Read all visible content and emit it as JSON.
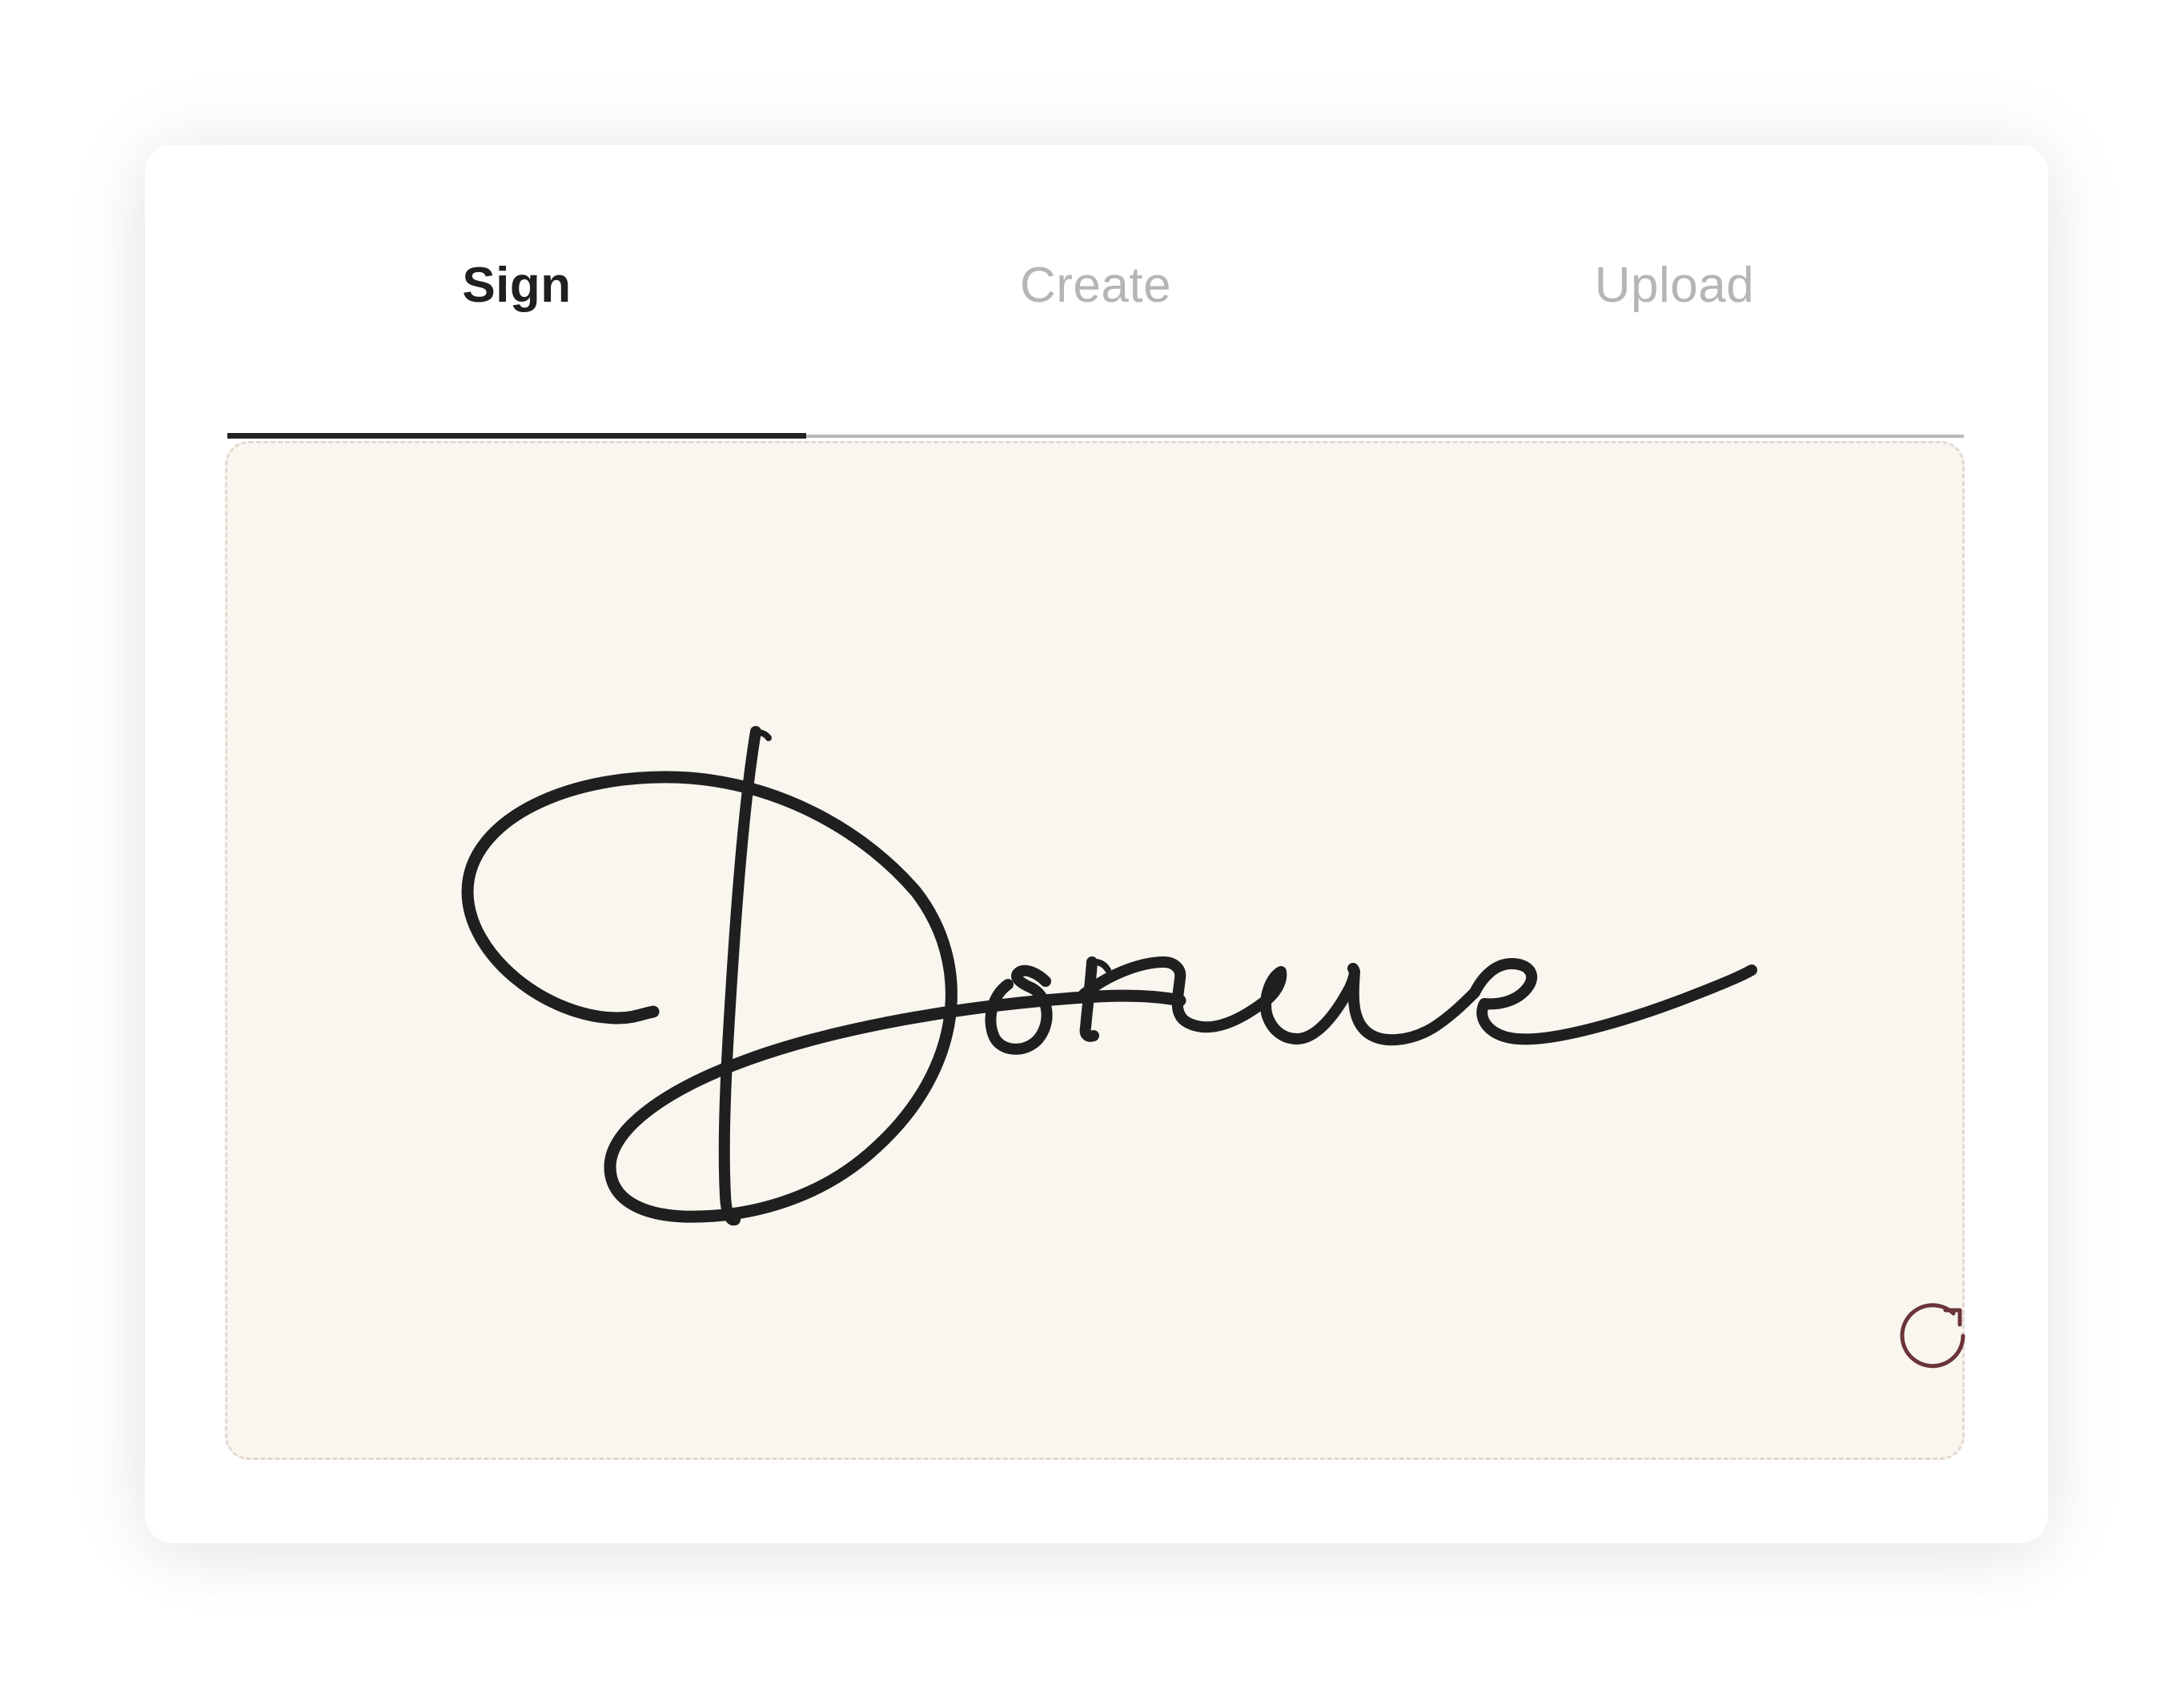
{
  "tabs": {
    "items": [
      {
        "label": "Sign",
        "active": true
      },
      {
        "label": "Create",
        "active": false
      },
      {
        "label": "Upload",
        "active": false
      }
    ]
  },
  "signature_pad": {
    "signature_text": "Dorue",
    "background": "#f8f6ef",
    "ink_color": "#1f1f1f",
    "reset_icon": "rotate-cw-icon",
    "reset_icon_color": "#6b3438"
  },
  "colors": {
    "active_tab": "#1f1f1f",
    "inactive_tab": "#b5b5b5",
    "tab_indicator": "#222222",
    "tab_underline": "#b9b9b9"
  }
}
